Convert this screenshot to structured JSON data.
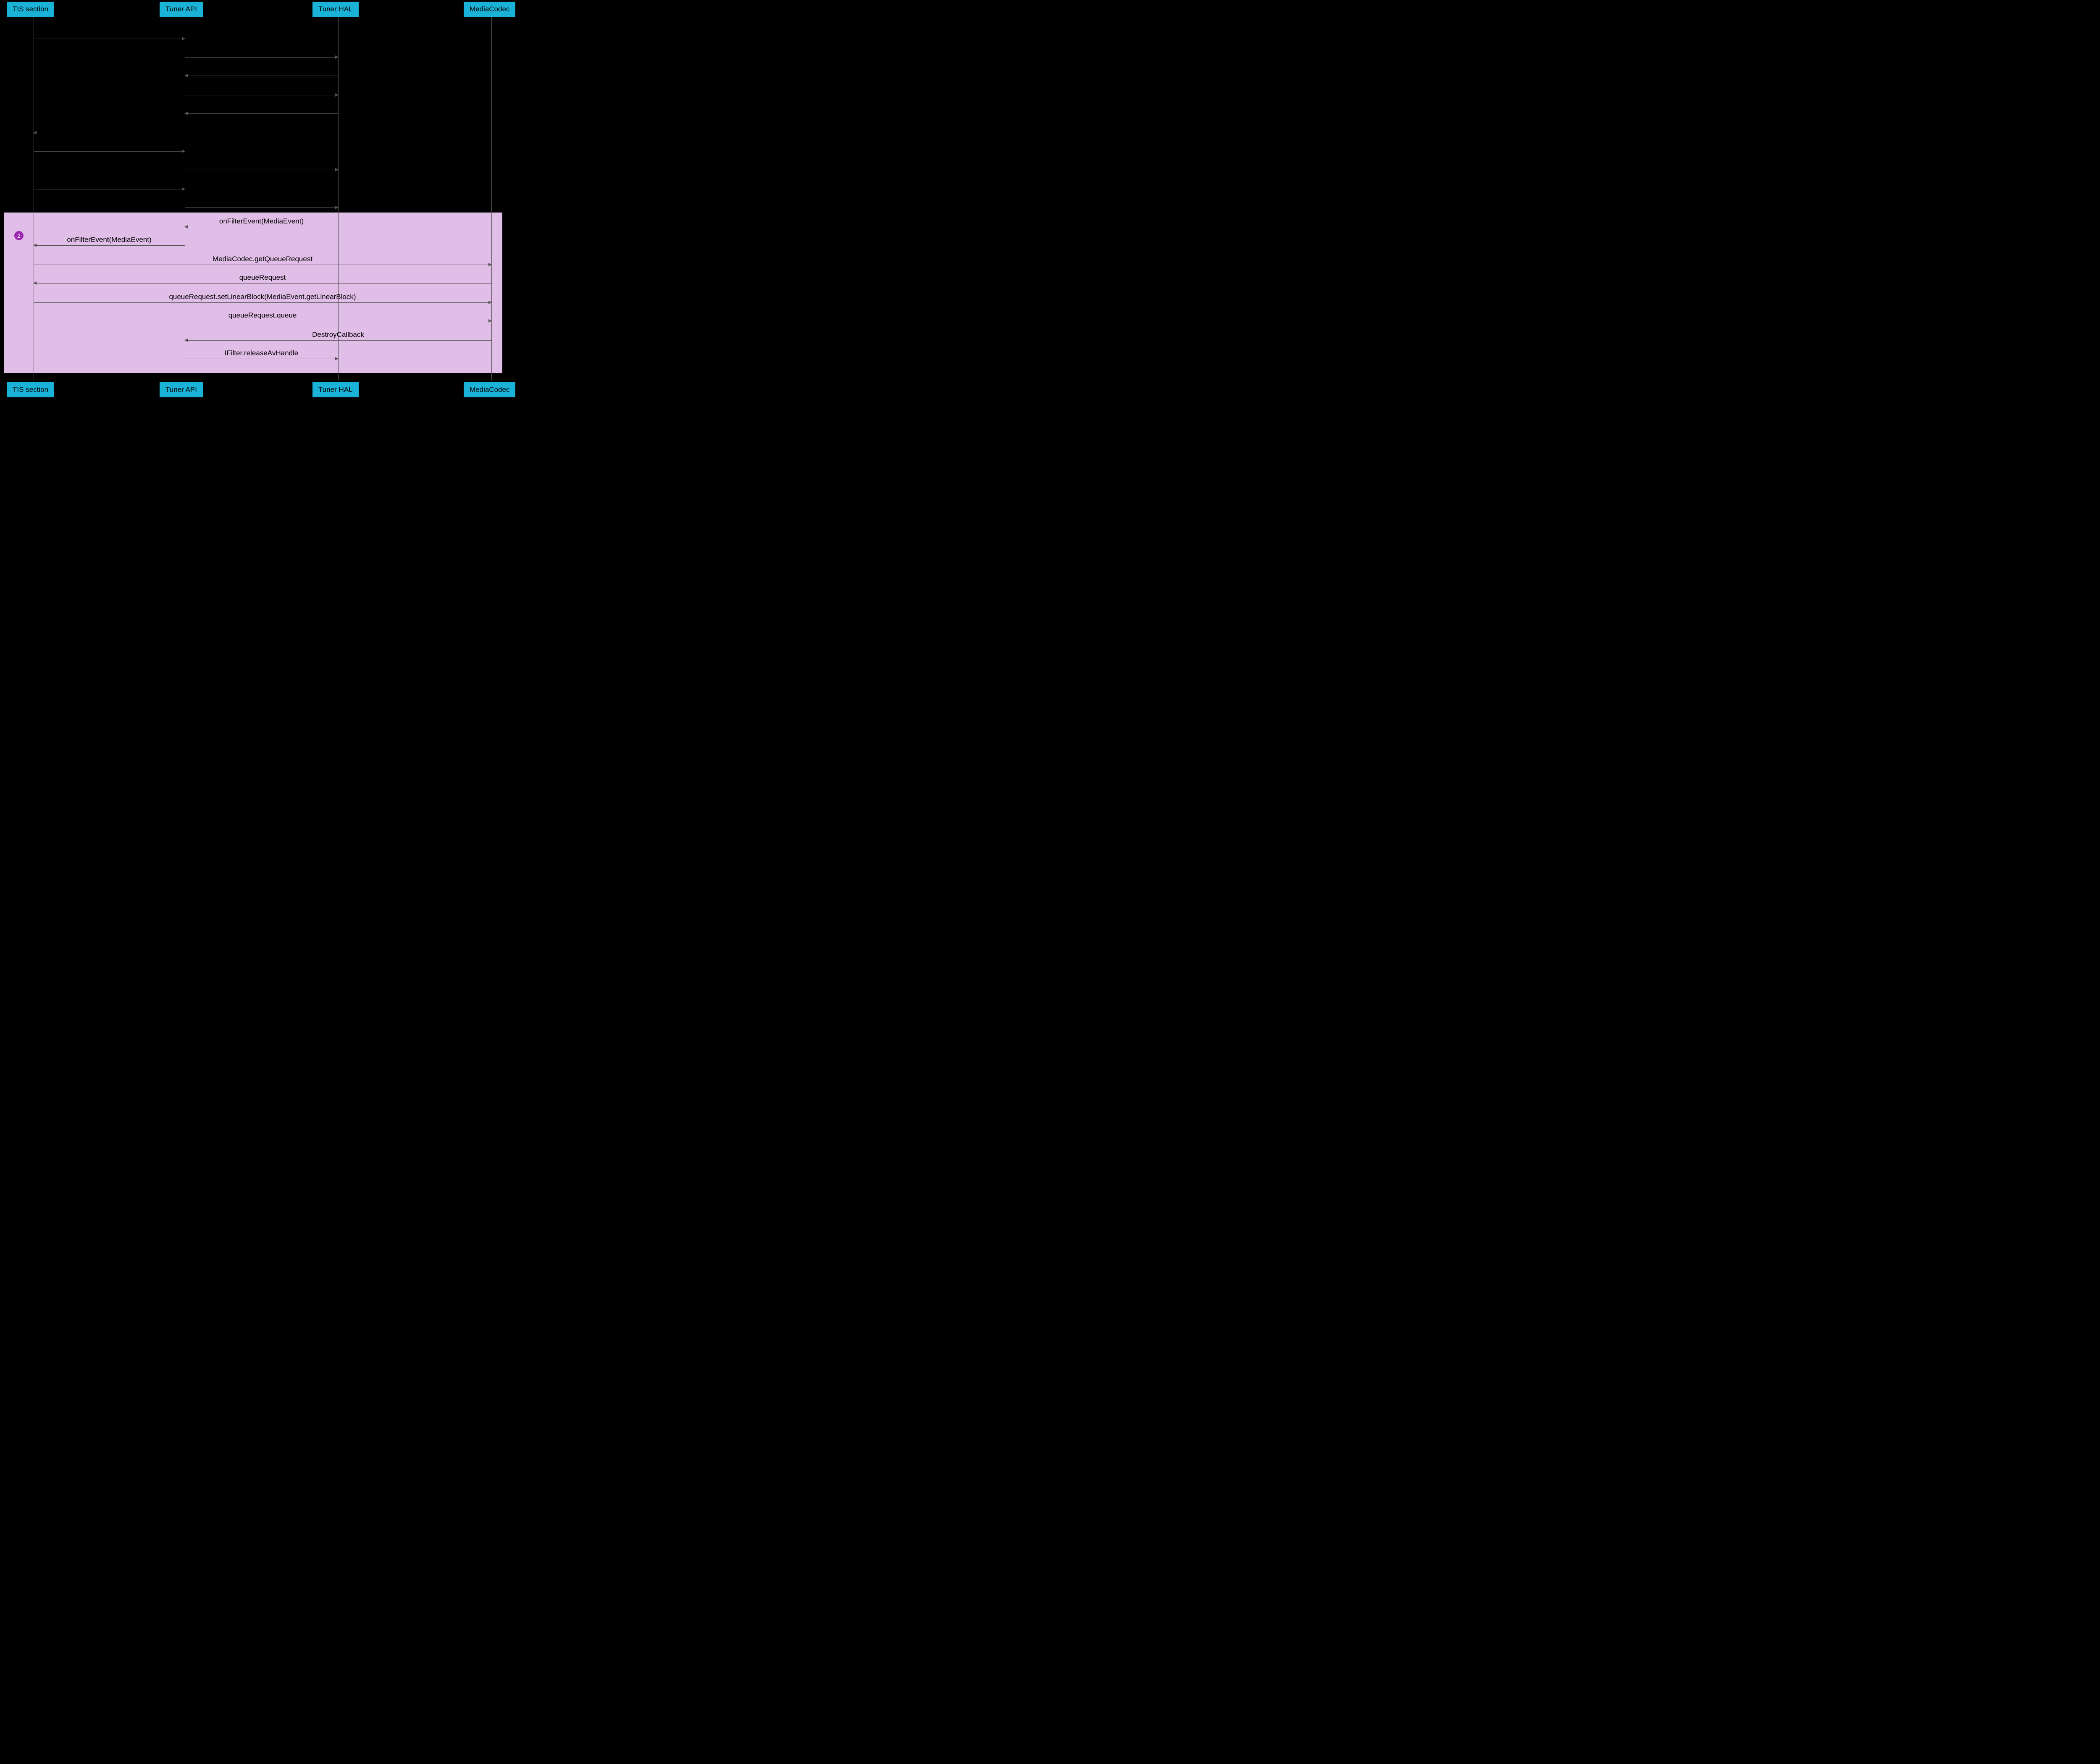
{
  "participants": {
    "p0": "TIS section",
    "p1": "Tuner API",
    "p2": "Tuner HAL",
    "p3": "MediaCodec"
  },
  "badge2": "2",
  "messages": {
    "m1_top": "onFilterEvent(MediaEvent)",
    "m2_top": "onFilterEvent(MediaEvent)",
    "m3": "MediaCodec.getQueueRequest",
    "m4": "queueRequest",
    "m5": "queueRequest.setLinearBlock(MediaEvent.getLinearBlock)",
    "m6": "queueRequest.queue",
    "m7": "DestroyCallback",
    "m8": "IFilter.releaseAvHandle"
  }
}
